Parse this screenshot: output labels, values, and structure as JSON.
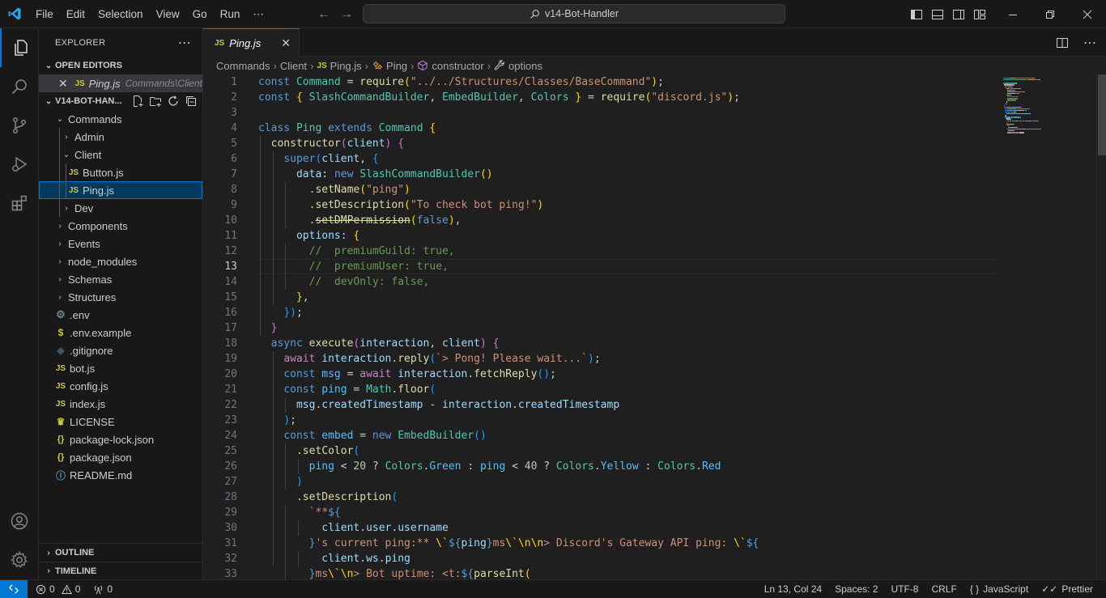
{
  "titlebar": {
    "menu": [
      "File",
      "Edit",
      "Selection",
      "View",
      "Go",
      "Run",
      "⋯"
    ],
    "search": "v14-Bot-Handler"
  },
  "sidebar": {
    "title": "EXPLORER",
    "more": "⋯",
    "open_editors_label": "OPEN EDITORS",
    "open_editor": {
      "name": "Ping.js",
      "desc": "Commands\\Client"
    },
    "workspace_label": "V14-BOT-HAN...",
    "tree": [
      {
        "name": "Commands",
        "type": "folder-open",
        "depth": 0
      },
      {
        "name": "Admin",
        "type": "folder",
        "depth": 1
      },
      {
        "name": "Client",
        "type": "folder-open",
        "depth": 1
      },
      {
        "name": "Button.js",
        "type": "js",
        "depth": 2
      },
      {
        "name": "Ping.js",
        "type": "js",
        "depth": 2,
        "selected": true
      },
      {
        "name": "Dev",
        "type": "folder",
        "depth": 1
      },
      {
        "name": "Components",
        "type": "folder",
        "depth": 0
      },
      {
        "name": "Events",
        "type": "folder",
        "depth": 0
      },
      {
        "name": "node_modules",
        "type": "folder",
        "depth": 0
      },
      {
        "name": "Schemas",
        "type": "folder",
        "depth": 0
      },
      {
        "name": "Structures",
        "type": "folder",
        "depth": 0
      },
      {
        "name": ".env",
        "type": "env",
        "depth": 0
      },
      {
        "name": ".env.example",
        "type": "dollar",
        "depth": 0
      },
      {
        "name": ".gitignore",
        "type": "git",
        "depth": 0
      },
      {
        "name": "bot.js",
        "type": "js",
        "depth": 0
      },
      {
        "name": "config.js",
        "type": "js",
        "depth": 0
      },
      {
        "name": "index.js",
        "type": "js",
        "depth": 0
      },
      {
        "name": "LICENSE",
        "type": "license",
        "depth": 0
      },
      {
        "name": "package-lock.json",
        "type": "json",
        "depth": 0
      },
      {
        "name": "package.json",
        "type": "json",
        "depth": 0
      },
      {
        "name": "README.md",
        "type": "info",
        "depth": 0
      }
    ],
    "outline_label": "OUTLINE",
    "timeline_label": "TIMELINE"
  },
  "editor": {
    "tab": {
      "badge": "JS",
      "name": "Ping.js"
    },
    "breadcrumb": [
      "Commands",
      "Client",
      "Ping.js",
      "Ping",
      "constructor",
      "options"
    ],
    "current_line": 13,
    "lines": [
      [
        [
          "k",
          "const "
        ],
        [
          "t",
          "Command"
        ],
        [
          "p",
          " = "
        ],
        [
          "f",
          "require"
        ],
        [
          "y",
          "("
        ],
        [
          "s",
          "\"../../Structures/Classes/BaseCommand\""
        ],
        [
          "y",
          ")"
        ],
        [
          "p",
          ";"
        ]
      ],
      [
        [
          "k",
          "const "
        ],
        [
          "y",
          "{ "
        ],
        [
          "t",
          "SlashCommandBuilder"
        ],
        [
          "p",
          ", "
        ],
        [
          "t",
          "EmbedBuilder"
        ],
        [
          "p",
          ", "
        ],
        [
          "t",
          "Colors"
        ],
        [
          "y",
          " }"
        ],
        [
          "p",
          " = "
        ],
        [
          "f",
          "require"
        ],
        [
          "y",
          "("
        ],
        [
          "s",
          "\"discord.js\""
        ],
        [
          "y",
          ")"
        ],
        [
          "p",
          ";"
        ]
      ],
      [],
      [
        [
          "k",
          "class "
        ],
        [
          "t",
          "Ping "
        ],
        [
          "k",
          "extends "
        ],
        [
          "t",
          "Command "
        ],
        [
          "y",
          "{"
        ]
      ],
      [
        [
          "p",
          "  "
        ],
        [
          "f",
          "constructor"
        ],
        [
          "pk",
          "("
        ],
        [
          "v",
          "client"
        ],
        [
          "pk",
          ")"
        ],
        [
          "p",
          " "
        ],
        [
          "pk",
          "{"
        ]
      ],
      [
        [
          "p",
          "    "
        ],
        [
          "k",
          "super"
        ],
        [
          "bl",
          "("
        ],
        [
          "v",
          "client"
        ],
        [
          "p",
          ", "
        ],
        [
          "bl",
          "{"
        ]
      ],
      [
        [
          "p",
          "      "
        ],
        [
          "v",
          "data"
        ],
        [
          "p",
          ": "
        ],
        [
          "k",
          "new "
        ],
        [
          "t",
          "SlashCommandBuilder"
        ],
        [
          "y",
          "()"
        ]
      ],
      [
        [
          "p",
          "        ."
        ],
        [
          "f",
          "setName"
        ],
        [
          "y",
          "("
        ],
        [
          "s",
          "\"ping\""
        ],
        [
          "y",
          ")"
        ]
      ],
      [
        [
          "p",
          "        ."
        ],
        [
          "f",
          "setDescription"
        ],
        [
          "y",
          "("
        ],
        [
          "s",
          "\"To check bot ping!\""
        ],
        [
          "y",
          ")"
        ]
      ],
      [
        [
          "p",
          "        ."
        ],
        [
          "f",
          "setDMPermission",
          "strike"
        ],
        [
          "y",
          "("
        ],
        [
          "k",
          "false"
        ],
        [
          "y",
          ")"
        ],
        [
          "p",
          ","
        ]
      ],
      [
        [
          "p",
          "      "
        ],
        [
          "v",
          "options"
        ],
        [
          "p",
          ": "
        ],
        [
          "y",
          "{"
        ]
      ],
      [
        [
          "p",
          "        "
        ],
        [
          "cm",
          "//  premiumGuild: true,"
        ]
      ],
      [
        [
          "p",
          "        "
        ],
        [
          "cm",
          "//  premiumUser: true,"
        ]
      ],
      [
        [
          "p",
          "        "
        ],
        [
          "cm",
          "//  devOnly: false,"
        ]
      ],
      [
        [
          "p",
          "      "
        ],
        [
          "y",
          "}"
        ],
        [
          "p",
          ","
        ]
      ],
      [
        [
          "p",
          "    "
        ],
        [
          "bl",
          "}"
        ],
        [
          "bl",
          ")"
        ],
        [
          "p",
          ";"
        ]
      ],
      [
        [
          "p",
          "  "
        ],
        [
          "pk",
          "}"
        ]
      ],
      [
        [
          "p",
          "  "
        ],
        [
          "k",
          "async "
        ],
        [
          "f",
          "execute"
        ],
        [
          "pk",
          "("
        ],
        [
          "v",
          "interaction"
        ],
        [
          "p",
          ", "
        ],
        [
          "v",
          "client"
        ],
        [
          "pk",
          ")"
        ],
        [
          "p",
          " "
        ],
        [
          "pk",
          "{"
        ]
      ],
      [
        [
          "p",
          "    "
        ],
        [
          "c2",
          "await "
        ],
        [
          "v",
          "interaction"
        ],
        [
          "p",
          "."
        ],
        [
          "f",
          "reply"
        ],
        [
          "bl",
          "("
        ],
        [
          "s",
          "`> Pong! Please wait...`"
        ],
        [
          "bl",
          ")"
        ],
        [
          "p",
          ";"
        ]
      ],
      [
        [
          "p",
          "    "
        ],
        [
          "k",
          "const "
        ],
        [
          "d",
          "msg"
        ],
        [
          "p",
          " = "
        ],
        [
          "c2",
          "await "
        ],
        [
          "v",
          "interaction"
        ],
        [
          "p",
          "."
        ],
        [
          "f",
          "fetchReply"
        ],
        [
          "bl",
          "()"
        ],
        [
          "p",
          ";"
        ]
      ],
      [
        [
          "p",
          "    "
        ],
        [
          "k",
          "const "
        ],
        [
          "d",
          "ping"
        ],
        [
          "p",
          " = "
        ],
        [
          "t",
          "Math"
        ],
        [
          "p",
          "."
        ],
        [
          "f",
          "floor"
        ],
        [
          "bl",
          "("
        ]
      ],
      [
        [
          "p",
          "      "
        ],
        [
          "v",
          "msg"
        ],
        [
          "p",
          "."
        ],
        [
          "v",
          "createdTimestamp"
        ],
        [
          "p",
          " - "
        ],
        [
          "v",
          "interaction"
        ],
        [
          "p",
          "."
        ],
        [
          "v",
          "createdTimestamp"
        ]
      ],
      [
        [
          "p",
          "    "
        ],
        [
          "bl",
          ")"
        ],
        [
          "p",
          ";"
        ]
      ],
      [
        [
          "p",
          "    "
        ],
        [
          "k",
          "const "
        ],
        [
          "d",
          "embed"
        ],
        [
          "p",
          " = "
        ],
        [
          "k",
          "new "
        ],
        [
          "t",
          "EmbedBuilder"
        ],
        [
          "bl",
          "()"
        ]
      ],
      [
        [
          "p",
          "      ."
        ],
        [
          "f",
          "setColor"
        ],
        [
          "bl",
          "("
        ]
      ],
      [
        [
          "p",
          "        "
        ],
        [
          "d",
          "ping"
        ],
        [
          "p",
          " < "
        ],
        [
          "n",
          "20"
        ],
        [
          "p",
          " ? "
        ],
        [
          "t",
          "Colors"
        ],
        [
          "p",
          "."
        ],
        [
          "d",
          "Green"
        ],
        [
          "p",
          " : "
        ],
        [
          "d",
          "ping"
        ],
        [
          "p",
          " < "
        ],
        [
          "n",
          "40"
        ],
        [
          "p",
          " ? "
        ],
        [
          "t",
          "Colors"
        ],
        [
          "p",
          "."
        ],
        [
          "d",
          "Yellow"
        ],
        [
          "p",
          " : "
        ],
        [
          "t",
          "Colors"
        ],
        [
          "p",
          "."
        ],
        [
          "d",
          "Red"
        ]
      ],
      [
        [
          "p",
          "      "
        ],
        [
          "bl",
          ")"
        ]
      ],
      [
        [
          "p",
          "      ."
        ],
        [
          "f",
          "setDescription"
        ],
        [
          "bl",
          "("
        ]
      ],
      [
        [
          "p",
          "        "
        ],
        [
          "s",
          "`**"
        ],
        [
          "k",
          "${"
        ]
      ],
      [
        [
          "p",
          "          "
        ],
        [
          "v",
          "client"
        ],
        [
          "p",
          "."
        ],
        [
          "v",
          "user"
        ],
        [
          "p",
          "."
        ],
        [
          "v",
          "username"
        ]
      ],
      [
        [
          "p",
          "        "
        ],
        [
          "k",
          "}"
        ],
        [
          "s",
          "'s current ping:** "
        ],
        [
          "y",
          "\\`"
        ],
        [
          "k",
          "${"
        ],
        [
          "v",
          "ping"
        ],
        [
          "k",
          "}"
        ],
        [
          "s",
          "ms"
        ],
        [
          "y",
          "\\`\\n\\n"
        ],
        [
          "s",
          "> Discord's Gateway API ping: "
        ],
        [
          "y",
          "\\`"
        ],
        [
          "k",
          "${"
        ]
      ],
      [
        [
          "p",
          "          "
        ],
        [
          "v",
          "client"
        ],
        [
          "p",
          "."
        ],
        [
          "v",
          "ws"
        ],
        [
          "p",
          "."
        ],
        [
          "v",
          "ping"
        ]
      ],
      [
        [
          "p",
          "        "
        ],
        [
          "k",
          "}"
        ],
        [
          "s",
          "ms"
        ],
        [
          "y",
          "\\`\\n"
        ],
        [
          "s",
          "> Bot uptime: <t:"
        ],
        [
          "k",
          "${"
        ],
        [
          "f",
          "parseInt"
        ],
        [
          "y",
          "("
        ]
      ]
    ]
  },
  "statusbar": {
    "errors": "0",
    "warnings": "0",
    "ports": "0",
    "position": "Ln 13, Col 24",
    "spaces": "Spaces: 2",
    "encoding": "UTF-8",
    "eol": "CRLF",
    "language": "JavaScript",
    "formatter": "Prettier"
  },
  "colors": {
    "accent": "#0078d4",
    "js_badge": "#cbcb41",
    "selection": "#04395e"
  }
}
